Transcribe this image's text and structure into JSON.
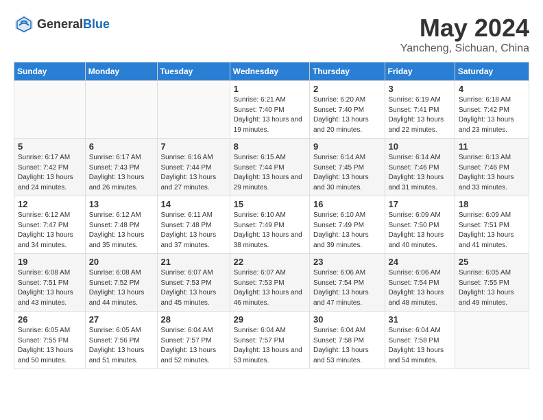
{
  "header": {
    "logo_general": "General",
    "logo_blue": "Blue",
    "title": "May 2024",
    "subtitle": "Yancheng, Sichuan, China"
  },
  "days_of_week": [
    "Sunday",
    "Monday",
    "Tuesday",
    "Wednesday",
    "Thursday",
    "Friday",
    "Saturday"
  ],
  "weeks": [
    [
      {
        "day": "",
        "info": ""
      },
      {
        "day": "",
        "info": ""
      },
      {
        "day": "",
        "info": ""
      },
      {
        "day": "1",
        "info": "Sunrise: 6:21 AM\nSunset: 7:40 PM\nDaylight: 13 hours and 19 minutes."
      },
      {
        "day": "2",
        "info": "Sunrise: 6:20 AM\nSunset: 7:40 PM\nDaylight: 13 hours and 20 minutes."
      },
      {
        "day": "3",
        "info": "Sunrise: 6:19 AM\nSunset: 7:41 PM\nDaylight: 13 hours and 22 minutes."
      },
      {
        "day": "4",
        "info": "Sunrise: 6:18 AM\nSunset: 7:42 PM\nDaylight: 13 hours and 23 minutes."
      }
    ],
    [
      {
        "day": "5",
        "info": "Sunrise: 6:17 AM\nSunset: 7:42 PM\nDaylight: 13 hours and 24 minutes."
      },
      {
        "day": "6",
        "info": "Sunrise: 6:17 AM\nSunset: 7:43 PM\nDaylight: 13 hours and 26 minutes."
      },
      {
        "day": "7",
        "info": "Sunrise: 6:16 AM\nSunset: 7:44 PM\nDaylight: 13 hours and 27 minutes."
      },
      {
        "day": "8",
        "info": "Sunrise: 6:15 AM\nSunset: 7:44 PM\nDaylight: 13 hours and 29 minutes."
      },
      {
        "day": "9",
        "info": "Sunrise: 6:14 AM\nSunset: 7:45 PM\nDaylight: 13 hours and 30 minutes."
      },
      {
        "day": "10",
        "info": "Sunrise: 6:14 AM\nSunset: 7:46 PM\nDaylight: 13 hours and 31 minutes."
      },
      {
        "day": "11",
        "info": "Sunrise: 6:13 AM\nSunset: 7:46 PM\nDaylight: 13 hours and 33 minutes."
      }
    ],
    [
      {
        "day": "12",
        "info": "Sunrise: 6:12 AM\nSunset: 7:47 PM\nDaylight: 13 hours and 34 minutes."
      },
      {
        "day": "13",
        "info": "Sunrise: 6:12 AM\nSunset: 7:48 PM\nDaylight: 13 hours and 35 minutes."
      },
      {
        "day": "14",
        "info": "Sunrise: 6:11 AM\nSunset: 7:48 PM\nDaylight: 13 hours and 37 minutes."
      },
      {
        "day": "15",
        "info": "Sunrise: 6:10 AM\nSunset: 7:49 PM\nDaylight: 13 hours and 38 minutes."
      },
      {
        "day": "16",
        "info": "Sunrise: 6:10 AM\nSunset: 7:49 PM\nDaylight: 13 hours and 39 minutes."
      },
      {
        "day": "17",
        "info": "Sunrise: 6:09 AM\nSunset: 7:50 PM\nDaylight: 13 hours and 40 minutes."
      },
      {
        "day": "18",
        "info": "Sunrise: 6:09 AM\nSunset: 7:51 PM\nDaylight: 13 hours and 41 minutes."
      }
    ],
    [
      {
        "day": "19",
        "info": "Sunrise: 6:08 AM\nSunset: 7:51 PM\nDaylight: 13 hours and 43 minutes."
      },
      {
        "day": "20",
        "info": "Sunrise: 6:08 AM\nSunset: 7:52 PM\nDaylight: 13 hours and 44 minutes."
      },
      {
        "day": "21",
        "info": "Sunrise: 6:07 AM\nSunset: 7:53 PM\nDaylight: 13 hours and 45 minutes."
      },
      {
        "day": "22",
        "info": "Sunrise: 6:07 AM\nSunset: 7:53 PM\nDaylight: 13 hours and 46 minutes."
      },
      {
        "day": "23",
        "info": "Sunrise: 6:06 AM\nSunset: 7:54 PM\nDaylight: 13 hours and 47 minutes."
      },
      {
        "day": "24",
        "info": "Sunrise: 6:06 AM\nSunset: 7:54 PM\nDaylight: 13 hours and 48 minutes."
      },
      {
        "day": "25",
        "info": "Sunrise: 6:05 AM\nSunset: 7:55 PM\nDaylight: 13 hours and 49 minutes."
      }
    ],
    [
      {
        "day": "26",
        "info": "Sunrise: 6:05 AM\nSunset: 7:55 PM\nDaylight: 13 hours and 50 minutes."
      },
      {
        "day": "27",
        "info": "Sunrise: 6:05 AM\nSunset: 7:56 PM\nDaylight: 13 hours and 51 minutes."
      },
      {
        "day": "28",
        "info": "Sunrise: 6:04 AM\nSunset: 7:57 PM\nDaylight: 13 hours and 52 minutes."
      },
      {
        "day": "29",
        "info": "Sunrise: 6:04 AM\nSunset: 7:57 PM\nDaylight: 13 hours and 53 minutes."
      },
      {
        "day": "30",
        "info": "Sunrise: 6:04 AM\nSunset: 7:58 PM\nDaylight: 13 hours and 53 minutes."
      },
      {
        "day": "31",
        "info": "Sunrise: 6:04 AM\nSunset: 7:58 PM\nDaylight: 13 hours and 54 minutes."
      },
      {
        "day": "",
        "info": ""
      }
    ]
  ]
}
